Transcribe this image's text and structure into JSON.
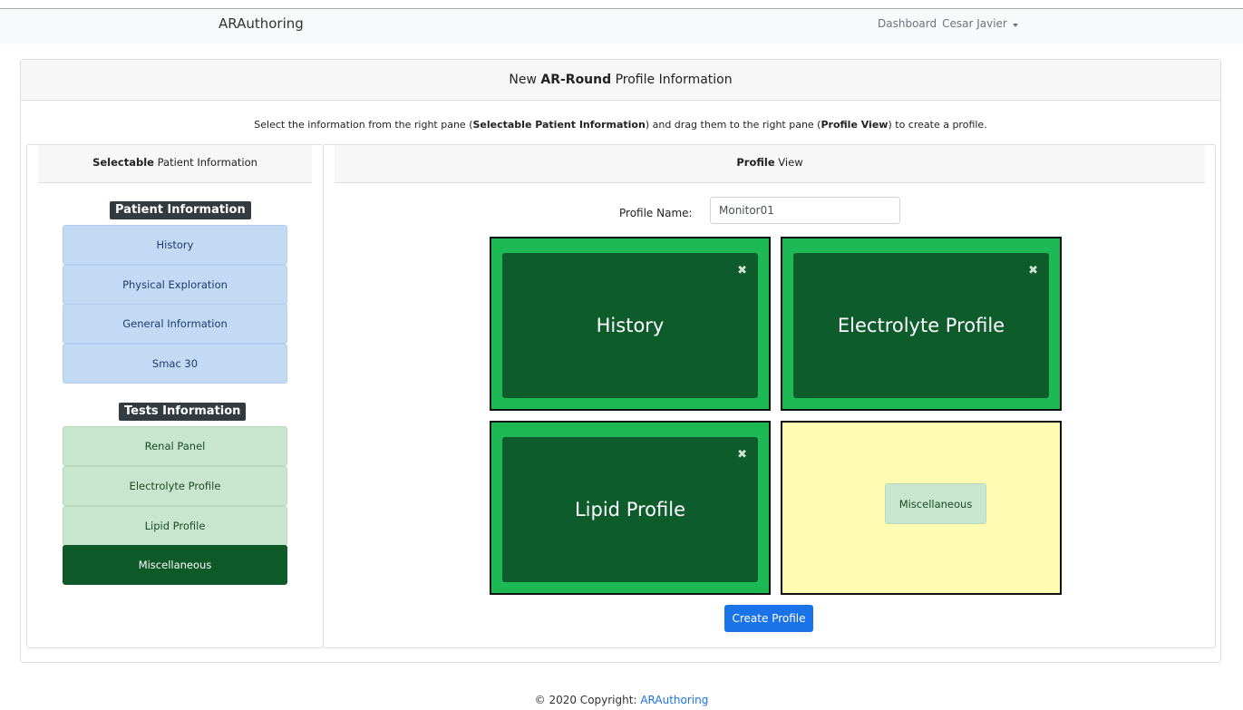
{
  "navbar": {
    "brand": "ARAuthoring",
    "dashboard": "Dashboard",
    "user": "Cesar Javier"
  },
  "card": {
    "title_prefix": "New ",
    "title_bold": "AR-Round",
    "title_suffix": " Profile Information",
    "instruction": {
      "t1": "Select the information from the right pane (",
      "b1": "Selectable Patient Information",
      "t2": ") and drag them to the right pane (",
      "b2": "Profile View",
      "t3": ") to create a profile."
    }
  },
  "left_pane": {
    "header_bold": "Selectable",
    "header_rest": " Patient Information",
    "patient_section": "Patient Information",
    "patient_items": [
      "History",
      "Physical Exploration",
      "General Information",
      "Smac 30"
    ],
    "tests_section": "Tests Information",
    "tests_items": [
      "Renal Panel",
      "Electrolyte Profile",
      "Lipid Profile",
      "Miscellaneous"
    ]
  },
  "right_pane": {
    "header_bold": "Profile",
    "header_rest": " View",
    "profile_name_label": "Profile Name:",
    "profile_name_value": "Monitor01",
    "slots": [
      {
        "title": "History",
        "close": "✖"
      },
      {
        "title": "Electrolyte Profile",
        "close": "✖"
      },
      {
        "title": "Lipid Profile",
        "close": "✖"
      },
      {
        "chip": "Miscellaneous"
      }
    ],
    "create_button": "Create Profile"
  },
  "footer": {
    "text": "© 2020 Copyright: ",
    "link": "ARAuthoring"
  },
  "colors": {
    "slot_filled": "#1db954",
    "widget": "#0e5c2c",
    "slot_empty": "#fffbb3",
    "primary": "#1a73e8"
  }
}
